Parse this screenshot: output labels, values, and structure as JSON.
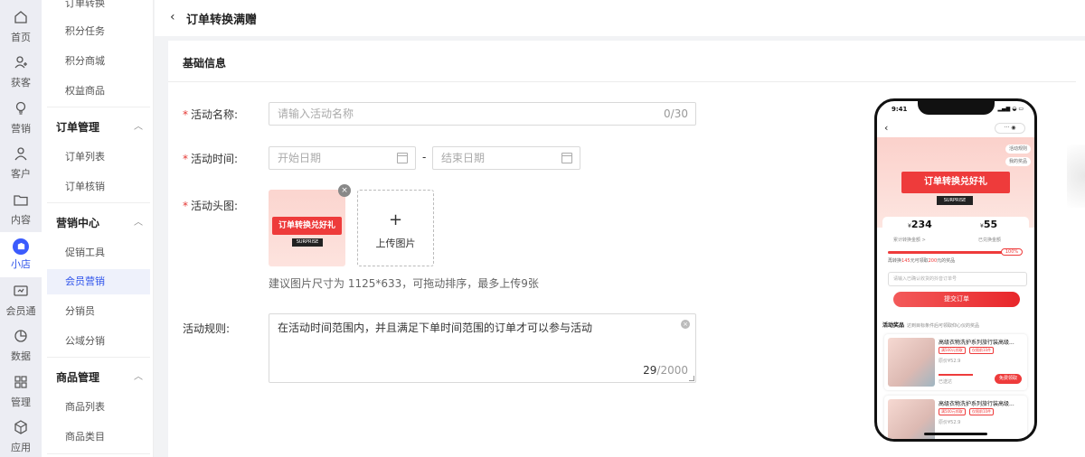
{
  "rail": [
    {
      "label": "首页",
      "icon": "home-icon"
    },
    {
      "label": "获客",
      "icon": "user-add-icon"
    },
    {
      "label": "营销",
      "icon": "bulb-icon"
    },
    {
      "label": "客户",
      "icon": "user-icon"
    },
    {
      "label": "内容",
      "icon": "folder-icon"
    },
    {
      "label": "小店",
      "icon": "shop-icon",
      "active": true
    },
    {
      "label": "会员通",
      "icon": "member-card-icon"
    },
    {
      "label": "数据",
      "icon": "pie-chart-icon"
    },
    {
      "label": "管理",
      "icon": "grid-icon"
    },
    {
      "label": "应用",
      "icon": "cube-icon"
    }
  ],
  "menu": {
    "top_partial": "订单转换",
    "items_a": [
      "积分任务",
      "积分商城",
      "权益商品"
    ],
    "group_order": "订单管理",
    "items_order": [
      "订单列表",
      "订单核销"
    ],
    "group_marketing": "营销中心",
    "items_marketing": [
      "促销工具",
      "会员营销",
      "分销员",
      "公域分销"
    ],
    "active_item": "会员营销",
    "group_goods": "商品管理",
    "items_goods": [
      "商品列表",
      "商品类目"
    ]
  },
  "header": {
    "back_icon": "chevron-left-icon",
    "title": "订单转换满赠"
  },
  "form": {
    "section_title": "基础信息",
    "name_label": "活动名称:",
    "name_placeholder": "请输入活动名称",
    "name_count": "0/30",
    "time_label": "活动时间:",
    "start_placeholder": "开始日期",
    "end_placeholder": "结束日期",
    "time_sep": "-",
    "image_label": "活动头图:",
    "upload_label": "上传图片",
    "upload_plus": "+",
    "thumb_banner": "订单转换兑好礼",
    "thumb_tag": "SURPRISE",
    "image_hint": "建议图片尺寸为 1125*633，可拖动排序，最多上传9张",
    "rules_label": "活动规则:",
    "rules_value": "在活动时间范围内，并且满足下单时间范围的订单才可以参与活动",
    "rules_count_current": "29",
    "rules_count_max": "/2000",
    "required_mark": "*"
  },
  "phone": {
    "time": "9:41",
    "status": "▂▄▆ ◒ ▭",
    "menu_dots": "··· ◉",
    "pill_rules": "活动规则",
    "pill_mine": "我的奖品",
    "banner": "订单转换兑好礼",
    "tag": "SURPRISE",
    "amount_left": "234",
    "amount_left_prefix": "¥",
    "amount_left_caption": "累计转换金额 >",
    "amount_right": "55",
    "amount_right_prefix": "¥",
    "amount_right_caption": "已兑换金额",
    "progress_pct": "100%",
    "progress_value": 1.0,
    "note_pre": "再转换",
    "note_amount": "145",
    "note_mid": "元可领取",
    "note_reward": "200",
    "note_post": "元的奖品",
    "input_placeholder": "请输入已确认收货的抖音订单号",
    "submit_label": "提交订单",
    "section_title": "活动奖品",
    "section_sub": "达到目标条件后可领取仰心仪的奖品",
    "products": [
      {
        "title": "高级衣物洗护系列旅行装高级...",
        "chip1": "满500元领取",
        "chip2": "仅限前10件",
        "price": "原价¥52.9",
        "status": "已送达",
        "button": "免费领取"
      },
      {
        "title": "高级衣物洗护系列旅行装高级...",
        "chip1": "满500元领取",
        "chip2": "仅限前10件",
        "price": "原价¥52.9"
      }
    ]
  }
}
